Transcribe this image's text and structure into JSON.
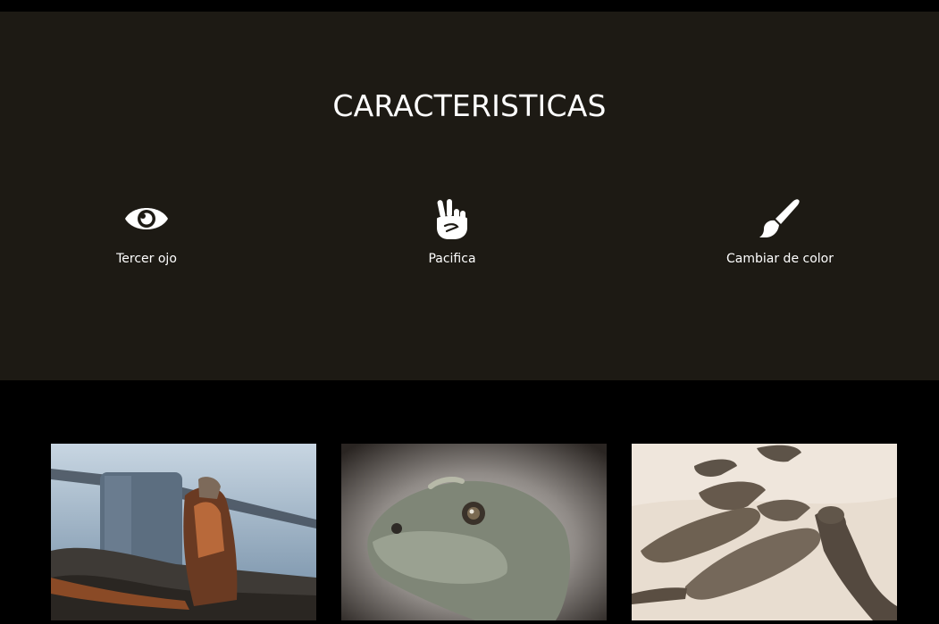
{
  "features": {
    "title": "CARACTERISTICAS",
    "items": [
      {
        "label": "Tercer ojo",
        "icon": "eye-icon"
      },
      {
        "label": "Pacifica",
        "icon": "peace-hand-icon"
      },
      {
        "label": "Cambiar de color",
        "icon": "paint-brush-icon"
      }
    ]
  },
  "gallery": {
    "photos": [
      {
        "subject": "iguana-on-rocks"
      },
      {
        "subject": "iguana-head-closeup"
      },
      {
        "subject": "iguanas-on-sand"
      }
    ]
  },
  "colors": {
    "features_bg": "#1d1a14",
    "page_bg": "#000000",
    "text": "#ffffff"
  }
}
